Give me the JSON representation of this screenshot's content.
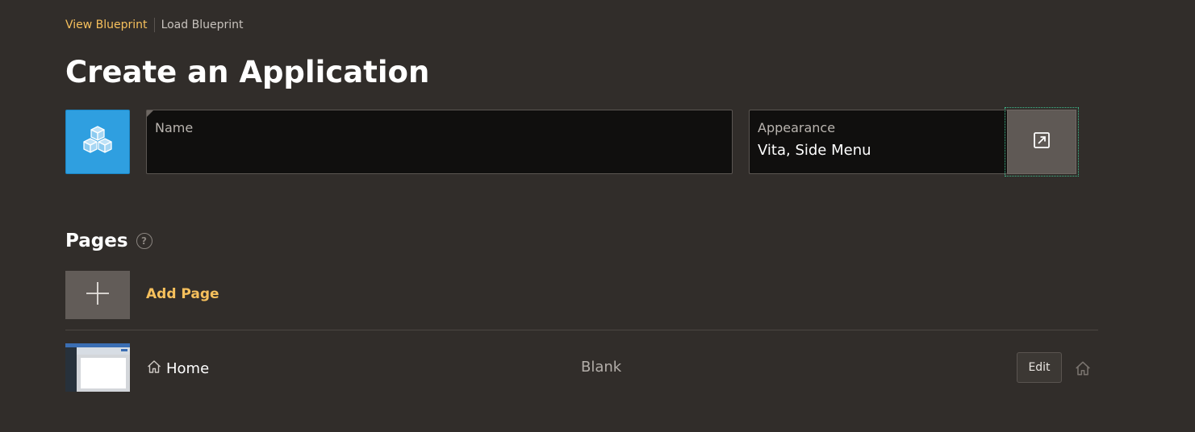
{
  "breadcrumbs": {
    "view_blueprint": "View Blueprint",
    "load_blueprint": "Load Blueprint"
  },
  "page_title": "Create an Application",
  "app_icon": {
    "icon": "cubes-icon",
    "color": "#2f9fe0"
  },
  "name_field": {
    "label": "Name",
    "value": "",
    "placeholder": ""
  },
  "appearance_field": {
    "label": "Appearance",
    "value": "Vita, Side Menu",
    "button_icon": "open-dialog-icon"
  },
  "pages_section": {
    "title": "Pages",
    "help_symbol": "?",
    "add_page_label": "Add Page",
    "items": [
      {
        "name": "Home",
        "type": "Blank",
        "edit_label": "Edit",
        "is_home": true
      }
    ]
  },
  "colors": {
    "background": "#312d2a",
    "accent": "#f6c05c",
    "field_bg": "#100f0e",
    "button_bg": "#625c58"
  }
}
